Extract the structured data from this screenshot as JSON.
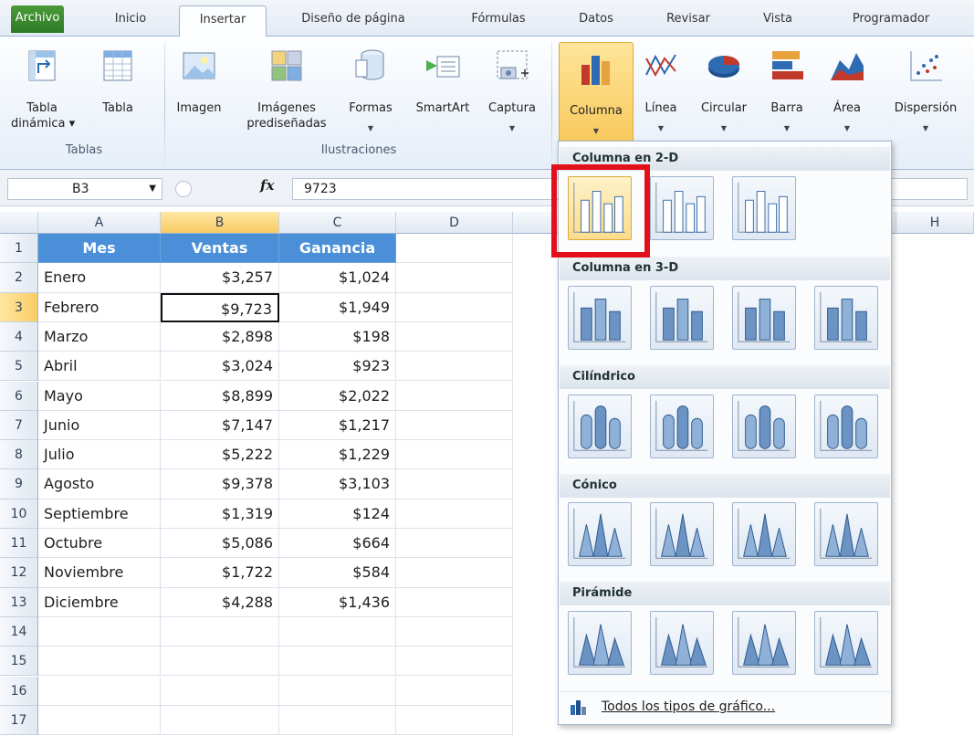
{
  "ribbon_tabs": [
    "Archivo",
    "Inicio",
    "Insertar",
    "Diseño de página",
    "Fórmulas",
    "Datos",
    "Revisar",
    "Vista",
    "Programador"
  ],
  "ribbon": {
    "tables_group": {
      "label": "Tablas",
      "pivot_label_1": "Tabla",
      "pivot_label_2": "dinámica ▾",
      "table_label": "Tabla"
    },
    "illustrations_group": {
      "label": "Ilustraciones",
      "image": "Imagen",
      "clipart_1": "Imágenes",
      "clipart_2": "prediseñadas",
      "shapes": "Formas",
      "smartart": "SmartArt",
      "capture": "Captura"
    },
    "charts_group": {
      "column": "Columna",
      "line": "Línea",
      "pie": "Circular",
      "bar": "Barra",
      "area": "Área",
      "scatter": "Dispersión"
    }
  },
  "formula_bar": {
    "name_box": "B3",
    "fx": "fx",
    "value": "9723"
  },
  "columns": [
    "A",
    "B",
    "C",
    "D",
    "H"
  ],
  "rows": [
    "1",
    "2",
    "3",
    "4",
    "5",
    "6",
    "7",
    "8",
    "9",
    "10",
    "11",
    "12",
    "13",
    "14",
    "15",
    "16",
    "17"
  ],
  "table": {
    "headers": [
      "Mes",
      "Ventas",
      "Ganancia"
    ],
    "rows": [
      [
        "Enero",
        "$3,257",
        "$1,024"
      ],
      [
        "Febrero",
        "$9,723",
        "$1,949"
      ],
      [
        "Marzo",
        "$2,898",
        "$198"
      ],
      [
        "Abril",
        "$3,024",
        "$923"
      ],
      [
        "Mayo",
        "$8,899",
        "$2,022"
      ],
      [
        "Junio",
        "$7,147",
        "$1,217"
      ],
      [
        "Julio",
        "$5,222",
        "$1,229"
      ],
      [
        "Agosto",
        "$9,378",
        "$3,103"
      ],
      [
        "Septiembre",
        "$1,319",
        "$124"
      ],
      [
        "Octubre",
        "$5,086",
        "$664"
      ],
      [
        "Noviembre",
        "$1,722",
        "$584"
      ],
      [
        "Diciembre",
        "$4,288",
        "$1,436"
      ]
    ]
  },
  "gallery": {
    "sections": [
      "Columna en 2-D",
      "Columna en 3-D",
      "Cilíndrico",
      "Cónico",
      "Pirámide"
    ],
    "footer": "Todos los tipos de gráfico..."
  },
  "colors": {
    "highlight": "#e3101c",
    "header_fill": "#4a8fd8",
    "file_tab": "#2f7a25"
  }
}
